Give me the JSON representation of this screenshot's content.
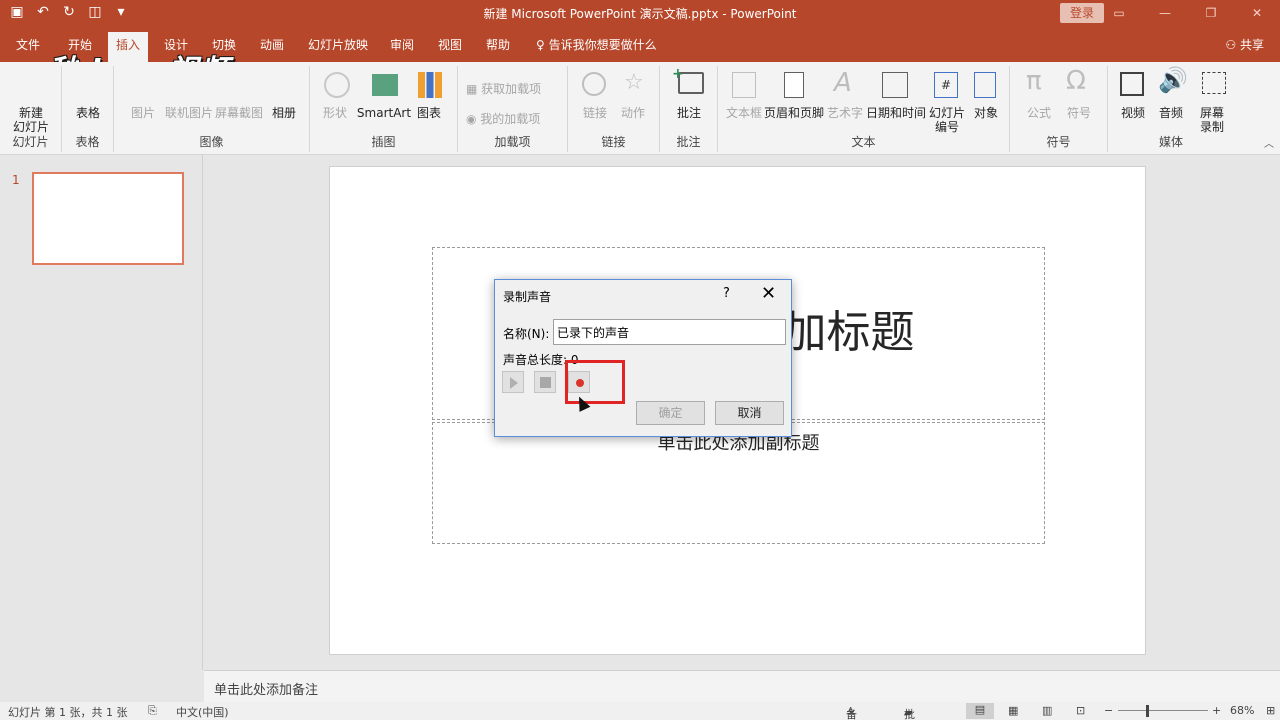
{
  "window": {
    "title": "新建 Microsoft PowerPoint 演示文稿.pptx  -  PowerPoint",
    "login": "登录",
    "share": "共享"
  },
  "watermark": "秒dong视频",
  "tabs": [
    "文件",
    "开始",
    "插入",
    "设计",
    "切换",
    "动画",
    "幻灯片放映",
    "审阅",
    "视图",
    "帮助"
  ],
  "active_tab": "插入",
  "tell_me": "告诉我你想要做什么",
  "ribbon": {
    "groups": {
      "slides": "幻灯片",
      "tables": "表格",
      "images": "图像",
      "illustrations": "插图",
      "addins": "加载项",
      "links": "链接",
      "comments": "批注",
      "text": "文本",
      "symbols": "符号",
      "media": "媒体"
    },
    "buttons": {
      "new_slide": "新建\n幻灯片",
      "table": "表格",
      "picture": "图片",
      "online_pic": "联机图片",
      "screenshot": "屏幕截图",
      "album": "相册",
      "shapes": "形状",
      "smartart": "SmartArt",
      "chart": "图表",
      "get_addins": "获取加载项",
      "my_addins": "我的加载项",
      "link": "链接",
      "action": "动作",
      "comment": "批注",
      "textbox": "文本框",
      "header_footer": "页眉和页脚",
      "wordart": "艺术字",
      "datetime": "日期和时间",
      "slide_number": "幻灯片\n编号",
      "object": "对象",
      "equation": "公式",
      "symbol": "符号",
      "video": "视频",
      "audio": "音频",
      "screen_record": "屏幕\n录制"
    }
  },
  "thumbnails": {
    "number": "1"
  },
  "slide": {
    "title_placeholder": "单击此处添加标题",
    "subtitle_placeholder": "单击此处添加副标题"
  },
  "notes": "单击此处添加备注",
  "status": {
    "slide_info": "幻灯片 第 1 张，共 1 张",
    "language": "中文(中国)",
    "notes_btn": "备注",
    "comments_btn": "批注",
    "zoom": "68%"
  },
  "dialog": {
    "title": "录制声音",
    "help": "?",
    "name_label": "名称(N):",
    "name_value": "已录下的声音",
    "length_label": "声音总长度:",
    "length_value": "0",
    "ok": "确定",
    "cancel": "取消"
  },
  "colors": {
    "accent": "#b7472a",
    "highlight": "#e02323"
  }
}
